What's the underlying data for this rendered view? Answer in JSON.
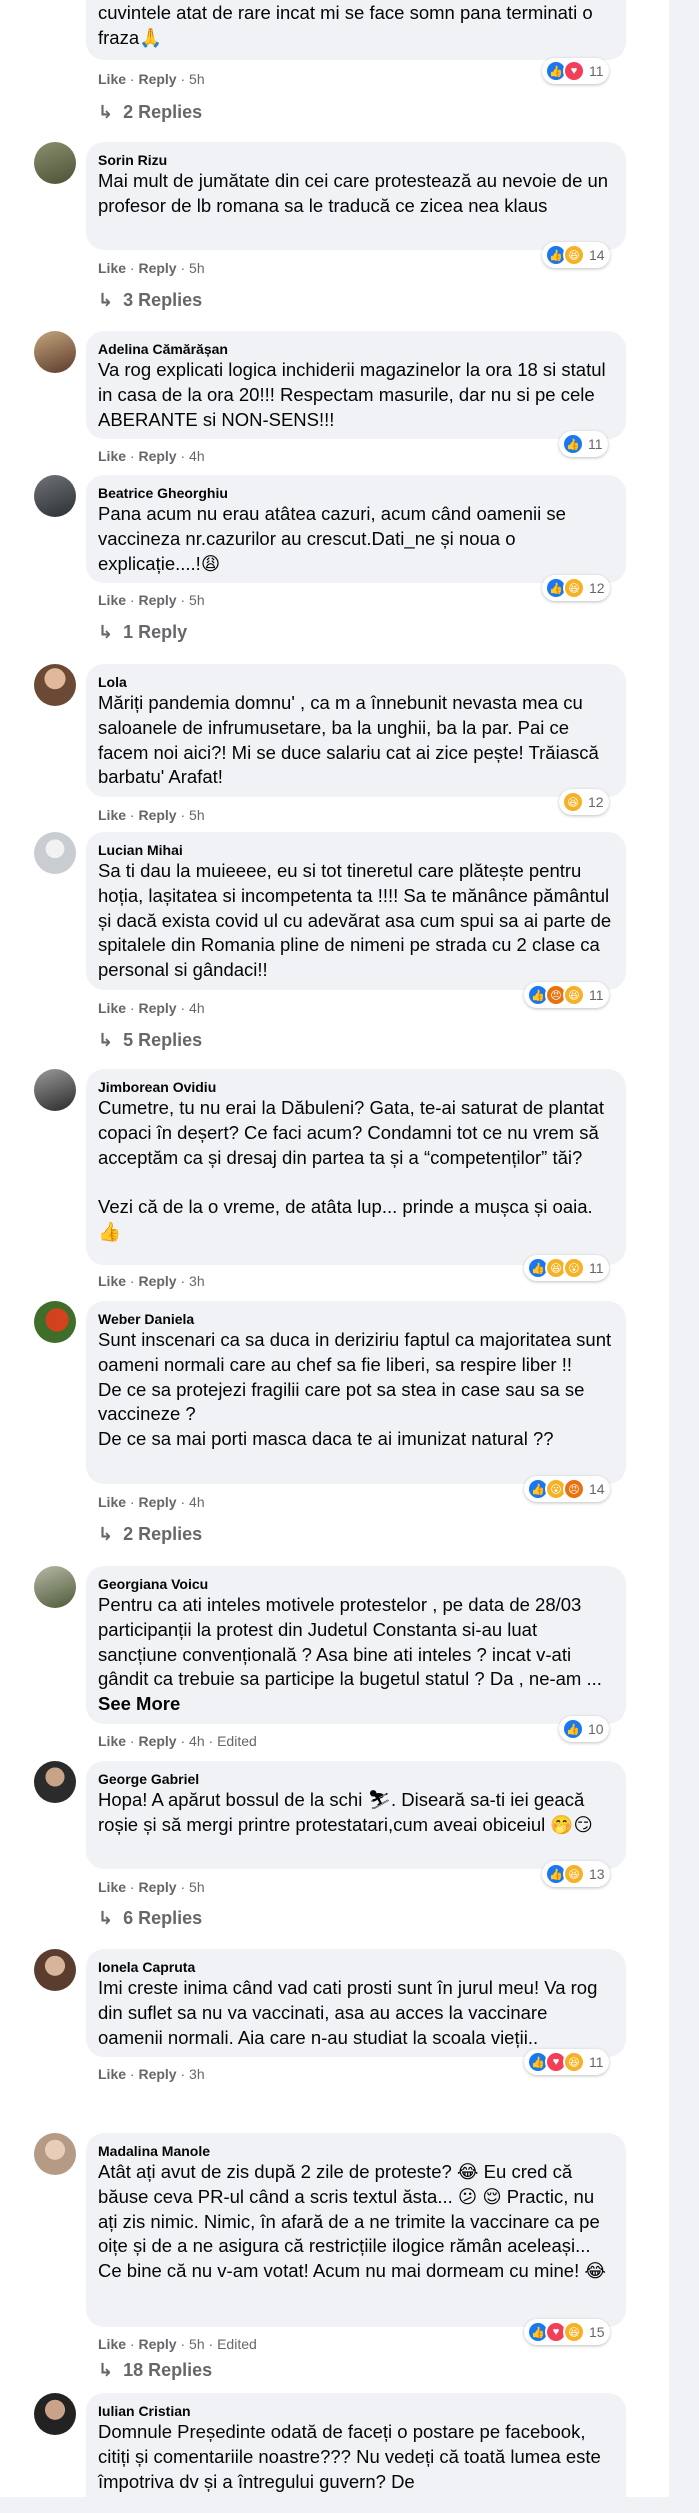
{
  "labels": {
    "like": "Like",
    "reply": "Reply",
    "dot": " · ",
    "see_more": "See More",
    "edited": "Edited"
  },
  "comments": [
    {
      "author": "",
      "text": "in fata poporului? Va rugă să vorbiți puțin mai hotărât si nu cu cuvintele atat de rare incat mi se face somn pana terminati o fraza🙏",
      "time": "5h",
      "reaction_count": "11",
      "replies": "2 Replies"
    },
    {
      "author": "Sorin Rizu",
      "text": "Mai mult de jumătate din cei care protestează au nevoie de un profesor de lb romana sa le traducă ce zicea nea klaus",
      "time": "5h",
      "reaction_count": "14",
      "replies": "3 Replies"
    },
    {
      "author": "Adelina Cămărășan",
      "text": "Va rog explicati logica inchiderii magazinelor la ora 18 si statul in casa de la ora 20!!! Respectam masurile, dar nu si pe cele ABERANTE si NON-SENS!!!",
      "time": "4h",
      "reaction_count": "11"
    },
    {
      "author": "Beatrice Gheorghiu",
      "text": "Pana acum nu erau atâtea cazuri, acum când oamenii se vaccineza nr.cazurilor au crescut.Dati_ne și noua o explicație....!😩",
      "time": "5h",
      "reaction_count": "12",
      "replies": "1 Reply"
    },
    {
      "author": "Lola",
      "text": "Măriți pandemia domnu' , ca m a înnebunit nevasta mea cu saloanele de infrumusetare, ba la unghii, ba la par. Pai ce facem noi aici?! Mi se duce salariu cat ai zice pește! Trăiască barbatu' Arafat!",
      "time": "5h",
      "reaction_count": "12"
    },
    {
      "author": "Lucian Mihai",
      "text": "Sa ti dau la muieeee, eu si tot tineretul care plătește pentru hoția, lașitatea si incompetenta ta !!!! Sa te mănânce pământul și dacă exista covid ul cu adevărat asa cum spui sa ai parte de spitalele din Romania pline de nimeni pe strada cu 2 clase ca personal si gândaci!!",
      "time": "4h",
      "reaction_count": "11",
      "replies": "5 Replies"
    },
    {
      "author": "Jimborean Ovidiu",
      "text": "Cumetre, tu nu erai la Dăbuleni? Gata, te-ai saturat de plantat copaci în deșert? Ce faci acum? Condamni tot ce nu vrem să acceptăm ca și dresaj din partea ta și a “competenților” tăi?\n\nVezi că de la o vreme, de atâta lup... prinde a mușca și oaia. 👍",
      "time": "3h",
      "reaction_count": "11"
    },
    {
      "author": "Weber Daniela",
      "text": "Sunt inscenari ca sa duca in deriziriu faptul ca majoritatea sunt oameni normali care au chef sa fie liberi, sa respire liber !!\nDe ce sa protejezi fragilii care pot sa stea in case sau sa se vaccineze ?\nDe ce sa mai porti masca daca te ai imunizat natural ??",
      "time": "4h",
      "reaction_count": "14",
      "replies": "2 Replies"
    },
    {
      "author": "Georgiana Voicu",
      "text": "Pentru ca ati inteles motivele protestelor , pe data de 28/03 participanții la protest din Judetul Constanta si-au luat sancțiune convențională ? Asa bine ati inteles ? incat v-ati gândit ca trebuie sa participe la bugetul statul ? Da , ne-am ...",
      "time": "4h",
      "edited": true,
      "reaction_count": "10"
    },
    {
      "author": "George Gabriel",
      "text": "Hopa! A apărut bossul de la schi ⛷. Diseară sa-ti iei geacă roșie și să mergi printre protestatari,cum aveai obiceiul 🤭😏",
      "time": "5h",
      "reaction_count": "13",
      "replies": "6 Replies"
    },
    {
      "author": "Ionela Capruta",
      "text": "Imi creste inima când vad cati prosti sunt în jurul meu! Va rog din suflet sa nu va vaccinati, asa au acces la vaccinare oamenii normali. Aia care n-au studiat la scoala vieții..",
      "time": "3h",
      "reaction_count": "11"
    },
    {
      "author": "Madalina Manole",
      "text": "Atât ați avut de zis după 2 zile de proteste? 😂 Eu cred că băuse ceva PR-ul când a scris textul ăsta... 😕 😌 Practic, nu ați zis nimic. Nimic, în afară de a ne trimite la vaccinare ca pe oițe și de a ne asigura că restricțiile ilogice rămân aceleași... Ce bine că nu v-am votat! Acum nu mai dormeam cu mine! 😂",
      "time": "5h",
      "edited": true,
      "reaction_count": "15",
      "replies": "18 Replies"
    },
    {
      "author": "Iulian Cristian",
      "text": "Domnule Președinte odată de faceți o postare pe facebook, citiți și comentariile noastre??? Nu vedeți că toată lumea este împotriva dv și a întregului guvern? De"
    }
  ]
}
